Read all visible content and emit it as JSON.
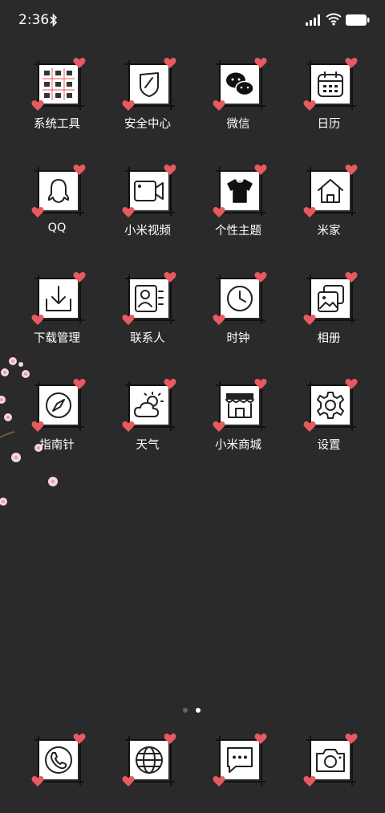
{
  "status_bar": {
    "time": "2:36"
  },
  "apps": [
    {
      "label": "系统工具",
      "icon": "grid-tools-icon"
    },
    {
      "label": "安全中心",
      "icon": "shield-icon"
    },
    {
      "label": "微信",
      "icon": "wechat-icon"
    },
    {
      "label": "日历",
      "icon": "calendar-icon"
    },
    {
      "label": "QQ",
      "icon": "penguin-icon"
    },
    {
      "label": "小米视频",
      "icon": "video-camera-icon"
    },
    {
      "label": "个性主题",
      "icon": "tshirt-icon"
    },
    {
      "label": "米家",
      "icon": "home-icon"
    },
    {
      "label": "下载管理",
      "icon": "download-icon"
    },
    {
      "label": "联系人",
      "icon": "contact-card-icon"
    },
    {
      "label": "时钟",
      "icon": "clock-icon"
    },
    {
      "label": "相册",
      "icon": "gallery-icon"
    },
    {
      "label": "指南针",
      "icon": "compass-icon"
    },
    {
      "label": "天气",
      "icon": "weather-icon"
    },
    {
      "label": "小米商城",
      "icon": "store-icon"
    },
    {
      "label": "设置",
      "icon": "gear-icon"
    }
  ],
  "dock": [
    {
      "icon": "phone-icon"
    },
    {
      "icon": "globe-icon"
    },
    {
      "icon": "message-icon"
    },
    {
      "icon": "camera-icon"
    }
  ],
  "page_indicator": {
    "current": 2,
    "total": 2
  },
  "colors": {
    "background": "#2a2a2a",
    "heart": "#e85a5f",
    "tile": "#ffffff",
    "label": "#ffffff"
  }
}
